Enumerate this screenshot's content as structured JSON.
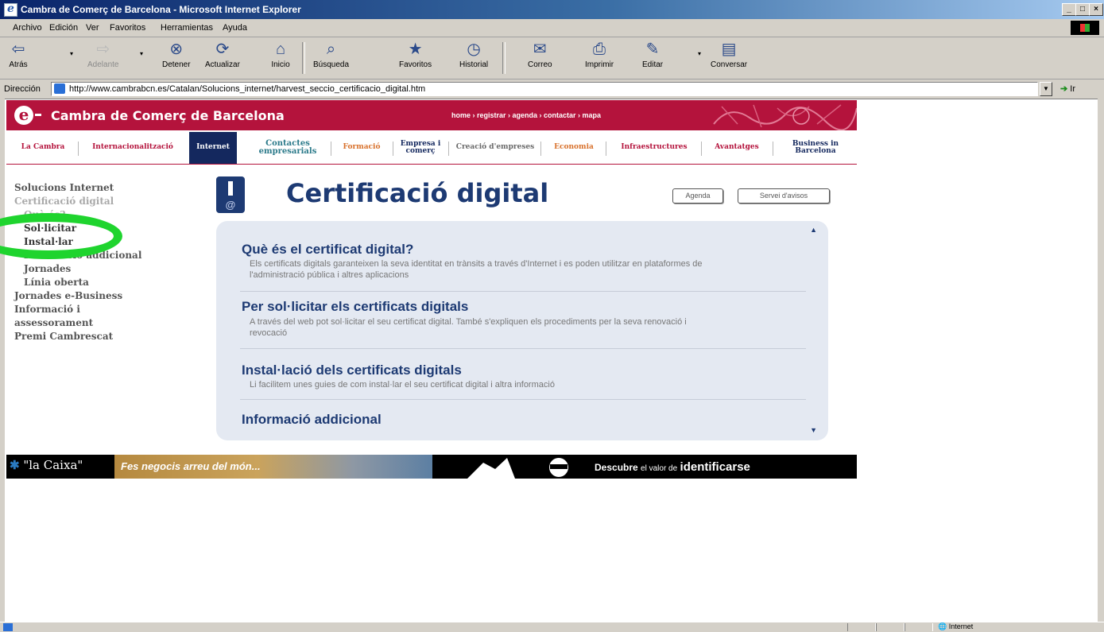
{
  "window": {
    "title": "Cambra de Comerç de Barcelona - Microsoft Internet Explorer",
    "minimize": "_",
    "maximize": "□",
    "close": "×"
  },
  "menu": [
    "Archivo",
    "Edición",
    "Ver",
    "Favoritos",
    "Herramientas",
    "Ayuda"
  ],
  "toolbar": {
    "back": "Atrás",
    "forward": "Adelante",
    "stop": "Detener",
    "refresh": "Actualizar",
    "home": "Inicio",
    "search": "Búsqueda",
    "favorites": "Favoritos",
    "history": "Historial",
    "mail": "Correo",
    "print": "Imprimir",
    "edit": "Editar",
    "discuss": "Conversar"
  },
  "address": {
    "label": "Dirección",
    "url": "http://www.cambrabcn.es/Catalan/Solucions_internet/harvest_seccio_certificacio_digital.htm",
    "go": "Ir"
  },
  "site": {
    "name": "Cambra de Comerç de Barcelona",
    "top_links": "home › registrar › agenda › contactar › mapa"
  },
  "nav": [
    "La Cambra",
    "Internacionalització",
    "Internet",
    "Contactes empresarials",
    "Formació",
    "Empresa i comerç",
    "Creació d'empreses",
    "Economia",
    "Infraestructures",
    "Avantatges",
    "Business in Barcelona"
  ],
  "sidebar": [
    "Solucions Internet",
    "Certificació digital",
    "Què és?",
    "Sol·licitar",
    "Instal·lar",
    "Informació addicional",
    "Jornades",
    "Línia oberta",
    "Jornades e-Business",
    "Informació i",
    "assessorament",
    "Premi Cambrescat"
  ],
  "main": {
    "title": "Certificació digital",
    "agenda_btn": "Agenda",
    "alert_btn": "Servei d'avisos",
    "items": [
      {
        "title": "Què és el certificat digital?",
        "desc": "Els certificats digitals garanteixen la seva identitat en trànsits a través d'Internet i es poden utilitzar en plataformes de l'administració pública i altres aplicacions"
      },
      {
        "title": "Per sol·licitar els certificats digitals",
        "desc": "A través del web pot sol·licitar el seu certificat digital. També s'expliquen els procediments per la seva renovació i revocació"
      },
      {
        "title": "Instal·lació dels certificats digitals",
        "desc": "Li facilitem unes guies de com instal·lar el seu certificat digital i altra informació"
      },
      {
        "title": "Informació addicional",
        "desc": ""
      }
    ]
  },
  "banner": {
    "logo": "\"la Caixa\"",
    "slogan": "Fes negocis arreu del món...",
    "cta_prefix": "Descubre",
    "cta_mid": "el valor de",
    "cta_word": "identificarse"
  },
  "status": {
    "zone": "Internet"
  },
  "colors": {
    "brand": "#b4133c",
    "navy": "#1d3a73",
    "panel": "#e4e9f2",
    "annotation": "#1fd42e"
  }
}
